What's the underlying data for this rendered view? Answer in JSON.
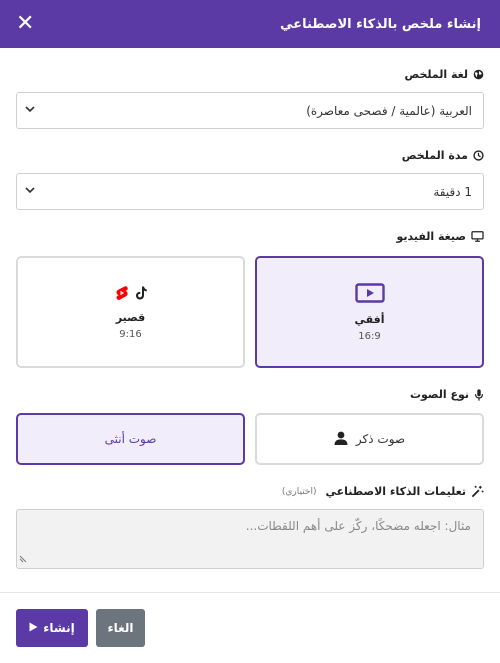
{
  "header": {
    "title": "إنشاء ملخص بالذكاء الاصطناعي",
    "close_label": "✕"
  },
  "language": {
    "label": "لغة الملخص",
    "value": "العربية (عالمية / فصحى معاصرة)"
  },
  "duration": {
    "label": "مدة الملخص",
    "value": "1 دقيقة"
  },
  "format": {
    "label": "صيغة الفيديو",
    "options": [
      {
        "name": "أفقي",
        "ratio": "16:9",
        "selected": true
      },
      {
        "name": "قصير",
        "ratio": "9:16",
        "selected": false
      }
    ]
  },
  "voice": {
    "label": "نوع الصوت",
    "male": "صوت ذكر",
    "female": "صوت أنثى",
    "selected": "female"
  },
  "instructions": {
    "label": "تعليمات الذكاء الاصطناعي",
    "hint": "(اختياري)",
    "placeholder": "مثال: اجعله مضحكًا، ركّز على أهم اللقطات..."
  },
  "footer": {
    "create_label": "إنشاء",
    "cancel_label": "الغاء"
  },
  "colors": {
    "accent": "#5b3aa6",
    "cancel": "#6c757d",
    "youtube": "#ff0000"
  }
}
